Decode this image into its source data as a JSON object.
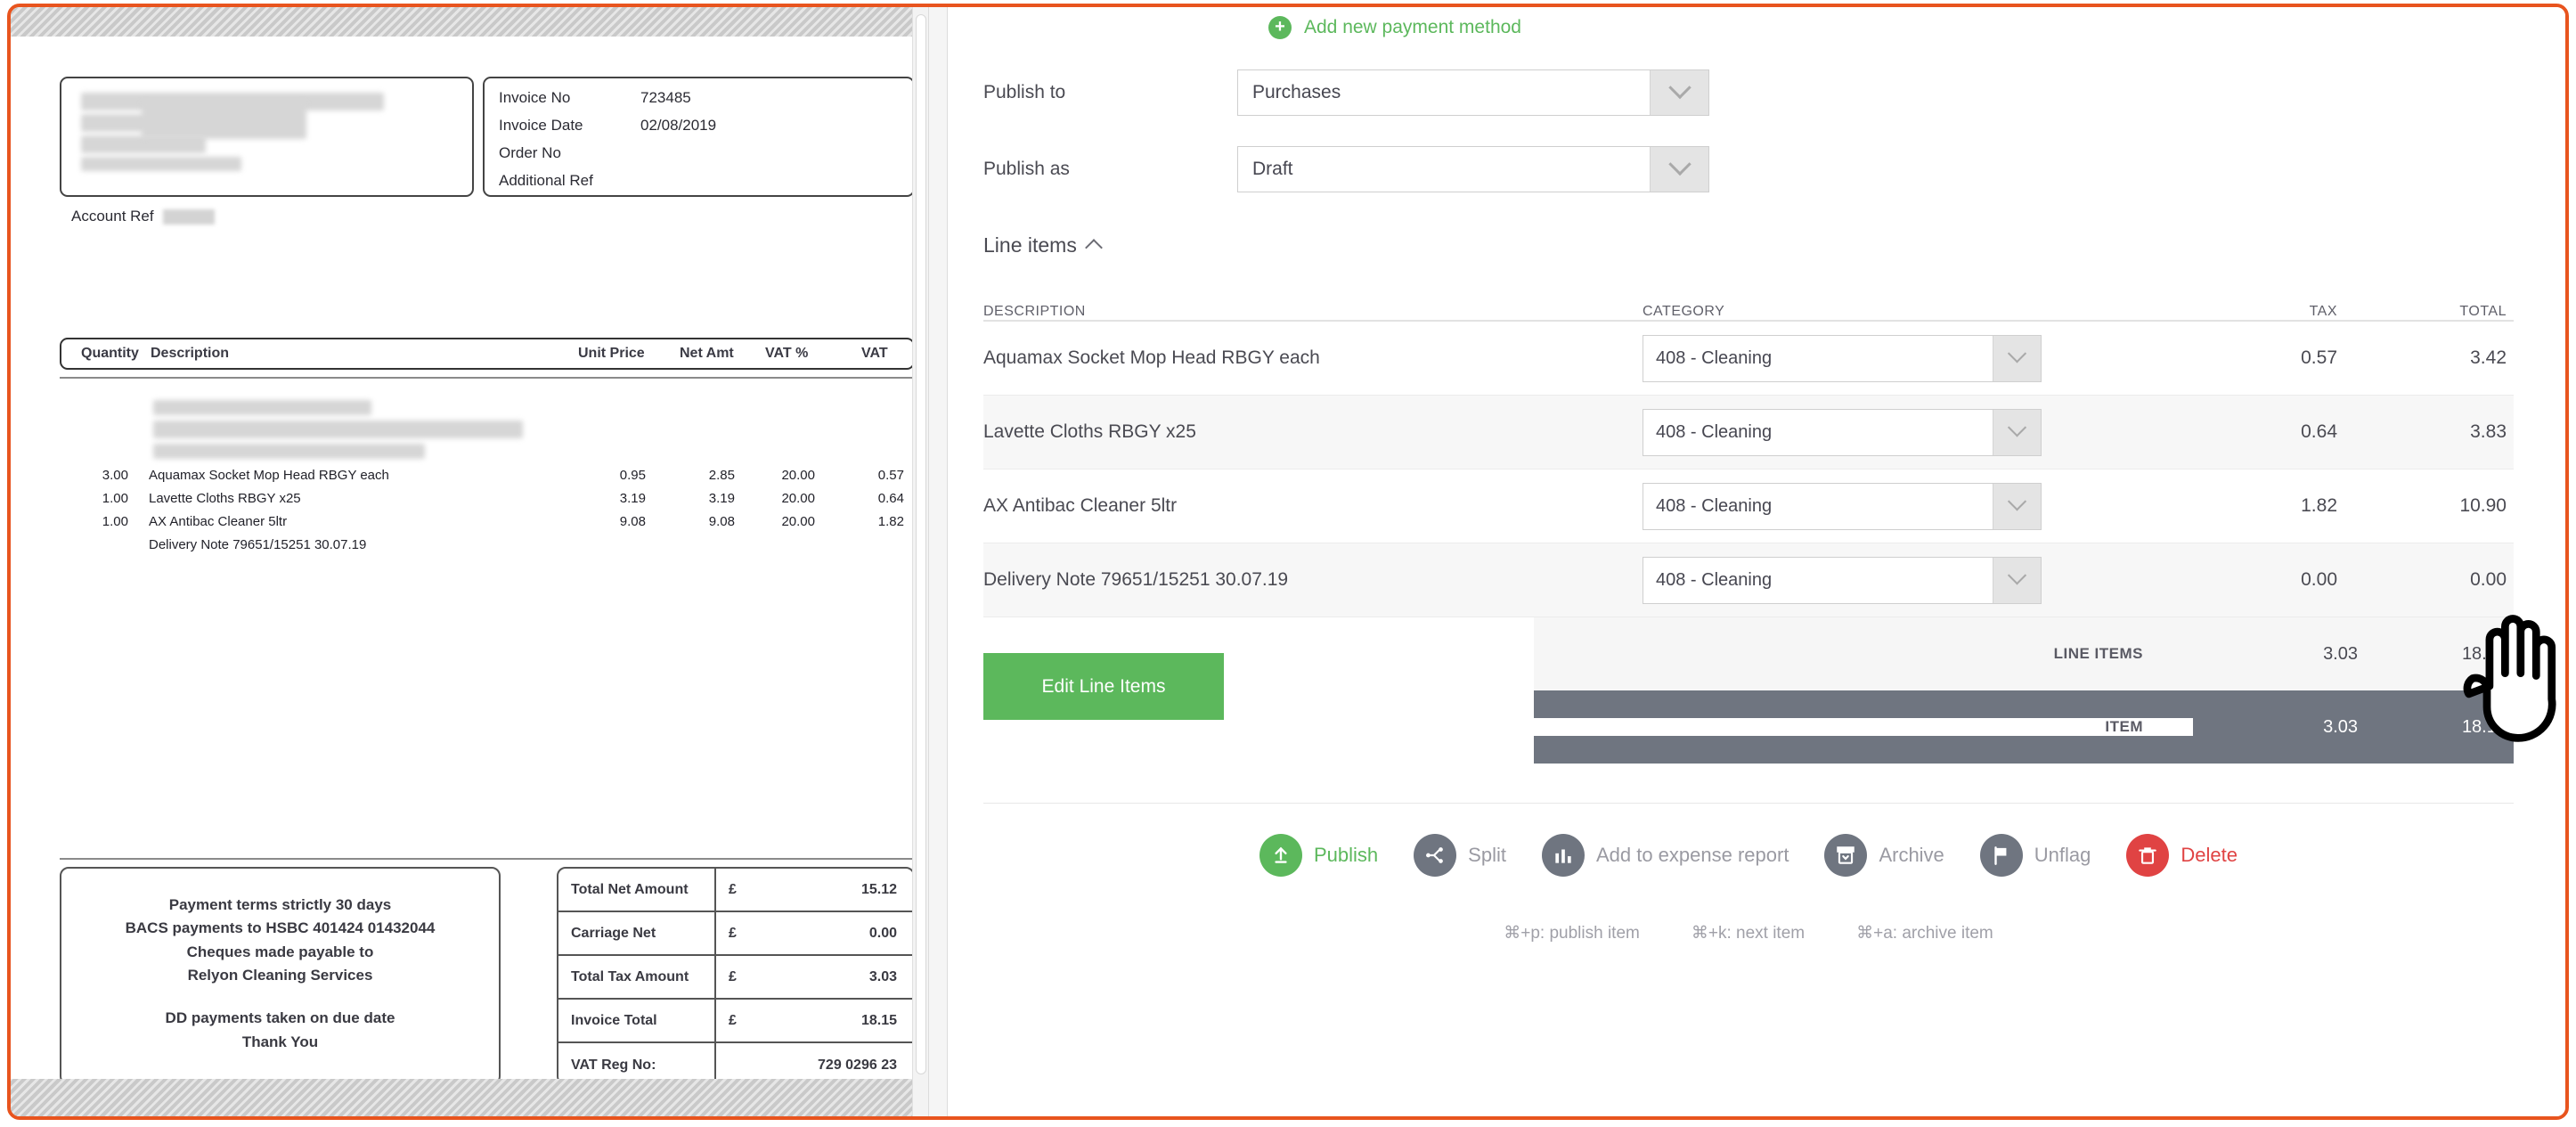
{
  "document": {
    "meta_box": [
      {
        "label": "Invoice No",
        "value": "723485"
      },
      {
        "label": "Invoice Date",
        "value": "02/08/2019"
      },
      {
        "label": "Order No",
        "value": ""
      },
      {
        "label": "Additional Ref",
        "value": ""
      }
    ],
    "account_ref_label": "Account Ref",
    "items_header": {
      "quantity": "Quantity",
      "description": "Description",
      "unit_price": "Unit Price",
      "net_amt": "Net Amt",
      "vat_pct": "VAT %",
      "vat": "VAT"
    },
    "items": [
      {
        "qty": "3.00",
        "desc": "Aquamax Socket Mop Head RBGY each",
        "unit": "0.95",
        "net": "2.85",
        "vatp": "20.00",
        "vat": "0.57"
      },
      {
        "qty": "1.00",
        "desc": "Lavette Cloths RBGY x25",
        "unit": "3.19",
        "net": "3.19",
        "vatp": "20.00",
        "vat": "0.64"
      },
      {
        "qty": "1.00",
        "desc": "AX Antibac Cleaner 5ltr",
        "unit": "9.08",
        "net": "9.08",
        "vatp": "20.00",
        "vat": "1.82"
      },
      {
        "qty": "",
        "desc": "Delivery Note 79651/15251 30.07.19",
        "unit": "",
        "net": "",
        "vatp": "",
        "vat": ""
      }
    ],
    "terms": {
      "line1": "Payment terms strictly 30 days",
      "line2": "BACS payments to HSBC 401424 01432044",
      "line3": "Cheques made payable to",
      "line4": "Relyon Cleaning Services",
      "line5": "DD payments taken on due date",
      "line6": "Thank You"
    },
    "totals": [
      {
        "label": "Total Net Amount",
        "symbol": "£",
        "amount": "15.12"
      },
      {
        "label": "Carriage Net",
        "symbol": "£",
        "amount": "0.00"
      },
      {
        "label": "Total Tax Amount",
        "symbol": "£",
        "amount": "3.03"
      },
      {
        "label": "Invoice Total",
        "symbol": "£",
        "amount": "18.15"
      },
      {
        "label": "VAT Reg No:",
        "symbol": "",
        "amount": "729 0296 23"
      }
    ]
  },
  "form": {
    "add_payment_method": "Add new payment method",
    "publish_to": {
      "label": "Publish to",
      "value": "Purchases"
    },
    "publish_as": {
      "label": "Publish as",
      "value": "Draft"
    },
    "line_items_title": "Line items",
    "table_headers": {
      "description": "DESCRIPTION",
      "category": "CATEGORY",
      "tax": "TAX",
      "total": "TOTAL"
    },
    "rows": [
      {
        "description": "Aquamax Socket Mop Head RBGY each",
        "category": "408 - Cleaning",
        "tax": "0.57",
        "total": "3.42"
      },
      {
        "description": "Lavette Cloths RBGY x25",
        "category": "408 - Cleaning",
        "tax": "0.64",
        "total": "3.83"
      },
      {
        "description": "AX Antibac Cleaner 5ltr",
        "category": "408 - Cleaning",
        "tax": "1.82",
        "total": "10.90"
      },
      {
        "description": "Delivery Note 79651/15251 30.07.19",
        "category": "408 - Cleaning",
        "tax": "0.00",
        "total": "0.00"
      }
    ],
    "edit_line_items_label": "Edit Line Items",
    "totals": [
      {
        "label": "LINE ITEMS",
        "tax": "3.03",
        "total": "18.15"
      },
      {
        "label": "ITEM",
        "tax": "3.03",
        "total": "18.15"
      }
    ]
  },
  "actions": [
    {
      "name": "publish",
      "label": "Publish",
      "icon": "upload-icon",
      "style": "green"
    },
    {
      "name": "split",
      "label": "Split",
      "icon": "split-icon",
      "style": "grey"
    },
    {
      "name": "add-to-expense-report",
      "label": "Add to expense report",
      "icon": "chart-icon",
      "style": "grey"
    },
    {
      "name": "archive",
      "label": "Archive",
      "icon": "archive-icon",
      "style": "grey"
    },
    {
      "name": "unflag",
      "label": "Unflag",
      "icon": "flag-icon",
      "style": "grey"
    },
    {
      "name": "delete",
      "label": "Delete",
      "icon": "trash-icon",
      "style": "red"
    }
  ],
  "shortcuts": [
    "⌘+p: publish item",
    "⌘+k: next item",
    "⌘+a: archive item"
  ],
  "colors": {
    "accent_orange": "#e8541e",
    "green": "#5cb85c",
    "grey": "#6f7580",
    "red": "#e04343"
  }
}
